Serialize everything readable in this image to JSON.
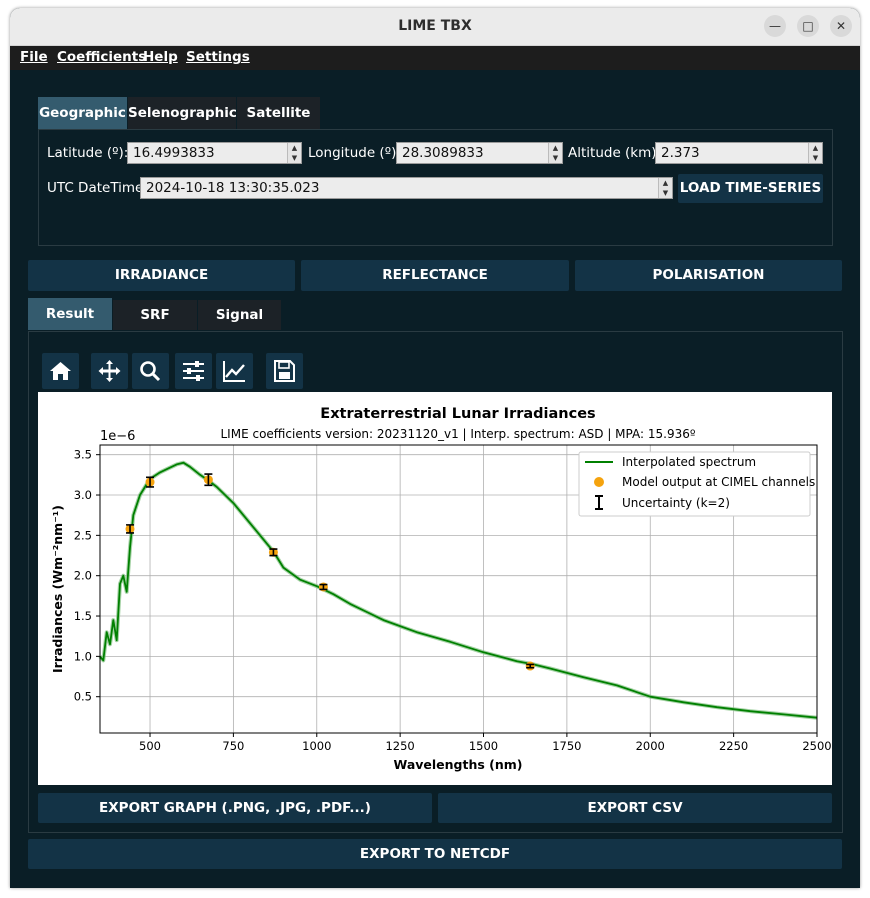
{
  "window": {
    "title": "LIME TBX"
  },
  "menu": [
    "File",
    "Coefficients",
    "Help",
    "Settings"
  ],
  "location_tabs": [
    "Geographic",
    "Selenographic",
    "Satellite"
  ],
  "form": {
    "latitude_label": "Latitude (º):",
    "latitude_value": "16.4993833",
    "longitude_label": "Longitude (º):",
    "longitude_value": "28.3089833",
    "altitude_label": "Altitude (km):",
    "altitude_value": "2.373",
    "datetime_label": "UTC DateTime:",
    "datetime_value": "2024-10-18 13:30:35.023",
    "load_button": "LOAD TIME-SERIES"
  },
  "actions": [
    "IRRADIANCE",
    "REFLECTANCE",
    "POLARISATION"
  ],
  "result_tabs": [
    "Result",
    "SRF",
    "Signal"
  ],
  "toolbar_icons": [
    "home-icon",
    "move-icon",
    "zoom-icon",
    "sliders-icon",
    "chart-line-icon",
    "save-icon"
  ],
  "export": {
    "graph": "EXPORT GRAPH (.PNG, .JPG, .PDF...)",
    "csv": "EXPORT CSV",
    "netcdf": "EXPORT TO NETCDF"
  },
  "colors": {
    "bg": "#0a1e26",
    "button": "#133346",
    "active_tab": "#345b6e",
    "series": "#008000",
    "points": "#f5a30e"
  },
  "chart_data": {
    "type": "line",
    "title": "Extraterrestrial Lunar Irradiances",
    "subtitle": "LIME coefficients version: 20231120_v1 | Interp. spectrum: ASD | MPA: 15.936º",
    "xlabel": "Wavelengths (nm)",
    "ylabel": "Irradiances (Wm⁻²nm⁻¹)",
    "y_multiplier": "1e−6",
    "xlim": [
      350,
      2500
    ],
    "ylim": [
      0.05,
      3.62
    ],
    "xticks": [
      500,
      750,
      1000,
      1250,
      1500,
      1750,
      2000,
      2250,
      2500
    ],
    "yticks": [
      0.5,
      1.0,
      1.5,
      2.0,
      2.5,
      3.0,
      3.5
    ],
    "xtick_labels": [
      "500",
      "750",
      "1000",
      "1250",
      "1500",
      "1750",
      "2000",
      "2250",
      "2500"
    ],
    "ytick_labels": [
      "0.5",
      "1.0",
      "1.5",
      "2.0",
      "2.5",
      "3.0",
      "3.5"
    ],
    "grid": true,
    "legend_position": "top-right",
    "legend": [
      "Interpolated spectrum",
      "Model output at CIMEL channels",
      "Uncertainty (k=2)"
    ],
    "series": [
      {
        "name": "Interpolated spectrum",
        "x": [
          350,
          360,
          370,
          380,
          390,
          400,
          410,
          420,
          430,
          440,
          450,
          470,
          500,
          530,
          550,
          580,
          600,
          620,
          650,
          675,
          700,
          750,
          800,
          850,
          870,
          900,
          950,
          1000,
          1050,
          1100,
          1150,
          1200,
          1300,
          1400,
          1500,
          1600,
          1650,
          1700,
          1800,
          1900,
          2000,
          2100,
          2200,
          2300,
          2400,
          2500
        ],
        "y": [
          1.0,
          0.95,
          1.3,
          1.15,
          1.45,
          1.2,
          1.9,
          2.0,
          1.8,
          2.35,
          2.75,
          3.0,
          3.2,
          3.28,
          3.32,
          3.38,
          3.4,
          3.35,
          3.25,
          3.18,
          3.1,
          2.9,
          2.65,
          2.4,
          2.3,
          2.1,
          1.95,
          1.87,
          1.77,
          1.65,
          1.55,
          1.45,
          1.3,
          1.18,
          1.05,
          0.94,
          0.9,
          0.85,
          0.74,
          0.64,
          0.5,
          0.43,
          0.37,
          0.32,
          0.28,
          0.24
        ]
      },
      {
        "name": "Model output at CIMEL channels",
        "x": [
          440,
          500,
          675,
          870,
          1020,
          1640
        ],
        "y": [
          2.58,
          3.16,
          3.19,
          2.29,
          1.86,
          0.88
        ],
        "err": [
          0.05,
          0.06,
          0.07,
          0.04,
          0.03,
          0.02
        ]
      }
    ]
  }
}
